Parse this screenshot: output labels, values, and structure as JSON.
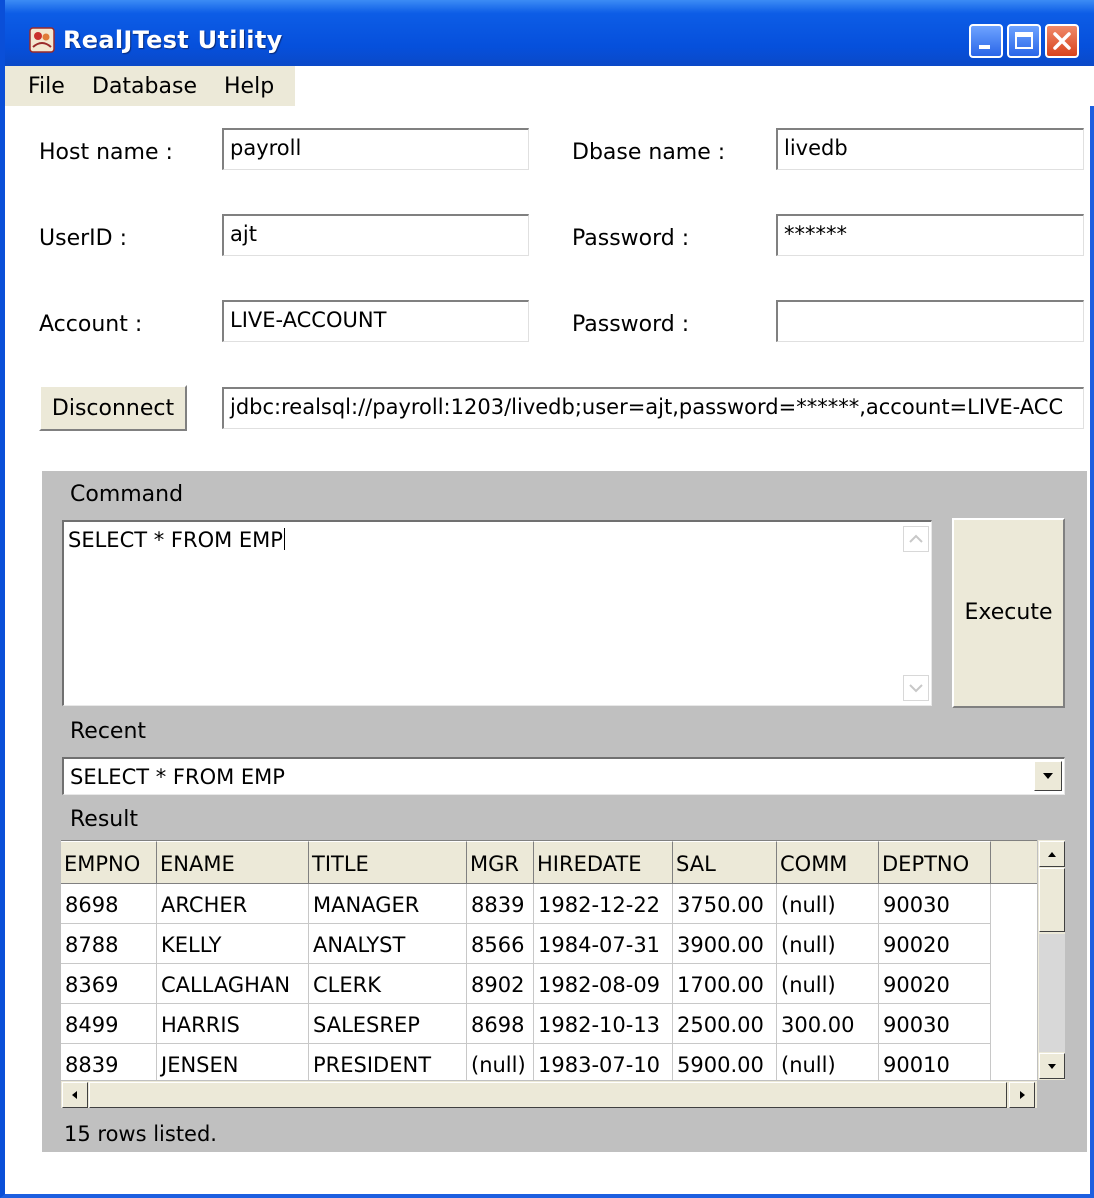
{
  "window": {
    "title": "RealJTest Utility"
  },
  "menu": {
    "items": [
      "File",
      "Database",
      "Help"
    ]
  },
  "connection": {
    "host_label": "Host name :",
    "host_value": "payroll",
    "dbase_label": "Dbase name :",
    "dbase_value": "livedb",
    "userid_label": "UserID :",
    "userid_value": "ajt",
    "password_label": "Password :",
    "password_value": "******",
    "account_label": "Account :",
    "account_value": "LIVE-ACCOUNT",
    "account_password_label": "Password :",
    "account_password_value": "",
    "disconnect_label": "Disconnect",
    "url_value": "jdbc:realsql://payroll:1203/livedb;user=ajt,password=******,account=LIVE-ACC"
  },
  "command": {
    "label": "Command",
    "text": "SELECT * FROM EMP",
    "execute_label": "Execute"
  },
  "recent": {
    "label": "Recent",
    "selected": "SELECT * FROM EMP"
  },
  "result": {
    "label": "Result",
    "columns": [
      "EMPNO",
      "ENAME",
      "TITLE",
      "MGR",
      "HIREDATE",
      "SAL",
      "COMM",
      "DEPTNO"
    ],
    "rows": [
      [
        "8698",
        "ARCHER",
        "MANAGER",
        "8839",
        "1982-12-22",
        "3750.00",
        "(null)",
        "90030"
      ],
      [
        "8788",
        "KELLY",
        "ANALYST",
        "8566",
        "1984-07-31",
        "3900.00",
        "(null)",
        "90020"
      ],
      [
        "8369",
        "CALLAGHAN",
        "CLERK",
        "8902",
        "1982-08-09",
        "1700.00",
        "(null)",
        "90020"
      ],
      [
        "8499",
        "HARRIS",
        "SALESREP",
        "8698",
        "1982-10-13",
        "2500.00",
        "300.00",
        "90030"
      ],
      [
        "8839",
        "JENSEN",
        "PRESIDENT",
        "(null)",
        "1983-07-10",
        "5900.00",
        "(null)",
        "90010"
      ]
    ],
    "status": "15 rows listed."
  }
}
